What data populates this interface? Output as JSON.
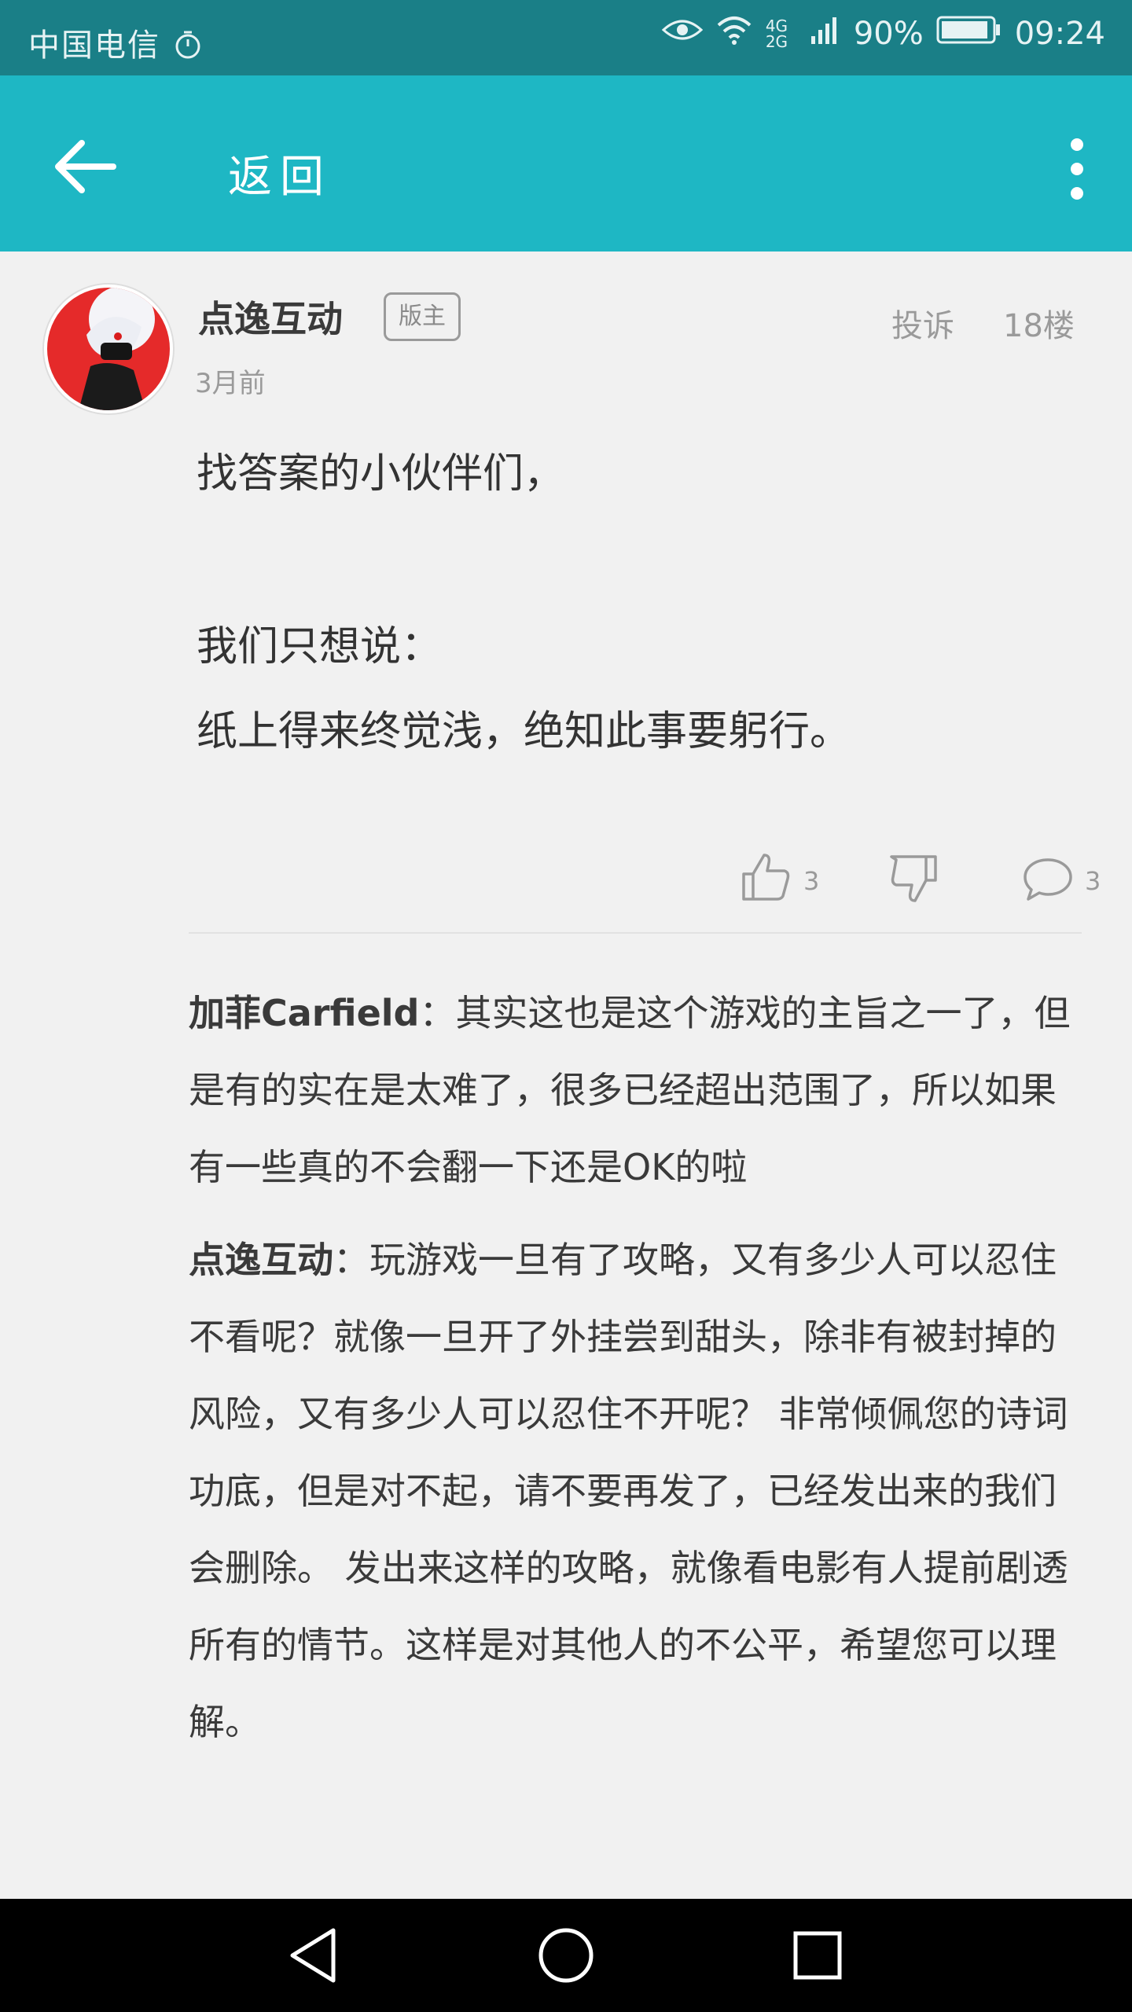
{
  "status_bar": {
    "carrier": "中国电信",
    "network": "4G 2G",
    "battery": "90%",
    "time": "09:24"
  },
  "app_bar": {
    "title": "返回"
  },
  "post": {
    "author": "点逸互动",
    "role": "版主",
    "time": "3月前",
    "report": "投诉",
    "floor": "18楼",
    "content_lines": [
      "找答案的小伙伴们，",
      "我们只想说：",
      "纸上得来终觉浅，绝知此事要躬行。"
    ],
    "likes": "3",
    "comments": "3"
  },
  "replies": [
    {
      "name": "加菲Carfield",
      "text": "其实这也是这个游戏的主旨之一了，但是有的实在是太难了，很多已经超出范围了，所以如果有一些真的不会翻一下还是OK的啦"
    },
    {
      "name": "点逸互动",
      "text": "玩游戏一旦有了攻略，又有多少人可以忍住不看呢？就像一旦开了外挂尝到甜头，除非有被封掉的风险，又有多少人可以忍住不开呢？ 非常倾佩您的诗词功底，但是对不起，请不要再发了，已经发出来的我们会删除。 发出来这样的攻略，就像看电影有人提前剧透所有的情节。这样是对其他人的不公平，希望您可以理解。"
    }
  ]
}
